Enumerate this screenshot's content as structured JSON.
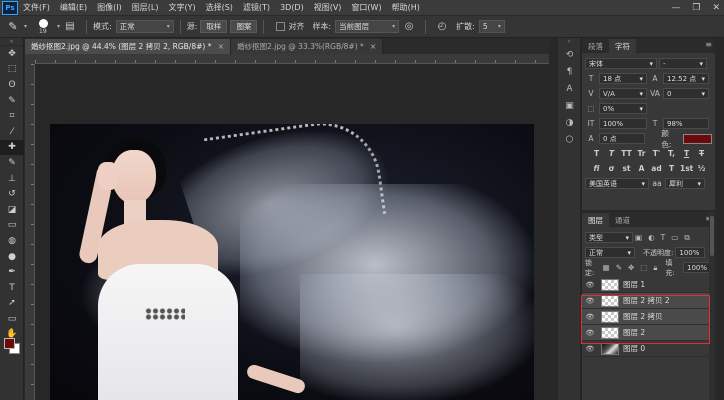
{
  "menu": {
    "logo": "Ps",
    "items": [
      "文件(F)",
      "编辑(E)",
      "图像(I)",
      "图层(L)",
      "文字(Y)",
      "选择(S)",
      "滤镜(T)",
      "3D(D)",
      "视图(V)",
      "窗口(W)",
      "帮助(H)"
    ],
    "window_controls": [
      "—",
      "❐",
      "✕"
    ]
  },
  "options": {
    "brush_size": "19",
    "mode_label": "模式:",
    "mode_value": "正常",
    "source_label": "源:",
    "sample_btn": "取样",
    "pattern_btn": "图案",
    "aligned_label": "对齐",
    "sample_label": "样本:",
    "sample_value": "当前图层",
    "diffuse_label": "扩散:",
    "diffuse_value": "5"
  },
  "tabs": [
    {
      "label": "婚纱抠图2.jpg @ 44.4% (图层 2 拷贝 2, RGB/8#) *",
      "close": "×"
    },
    {
      "label": "婚纱抠图2.jpg @ 33.3%(RGB/8#) *",
      "close": "×"
    }
  ],
  "toolbar": {
    "tools": [
      "move-icon",
      "marquee-icon",
      "lasso-icon",
      "quick-select-icon",
      "crop-icon",
      "eyedropper-icon",
      "healing-brush-icon",
      "brush-icon",
      "clone-stamp-icon",
      "history-brush-icon",
      "eraser-icon",
      "gradient-icon",
      "blur-icon",
      "dodge-icon",
      "pen-icon",
      "type-icon",
      "path-select-icon",
      "shape-icon",
      "hand-icon",
      "zoom-icon"
    ],
    "glyphs": [
      "✥",
      "⬚",
      "ʘ",
      "✎",
      "⌗",
      "⁄",
      "✚",
      "✎",
      "⊥",
      "↺",
      "◪",
      "▭",
      "◍",
      "●",
      "✒",
      "T",
      "➚",
      "▭",
      "✋",
      "⌕"
    ],
    "active_index": 6,
    "foreground_color": "#6b0b0b",
    "background_color": "#ffffff"
  },
  "character_panel": {
    "tabs": [
      "段落",
      "字符"
    ],
    "active_tab": 1,
    "font_family": "宋体",
    "font_style": "-",
    "font_size": "18 点",
    "leading": "12.52 点",
    "kerning": "V/A",
    "tracking": "0",
    "vertical_scale_field": "0%",
    "horizontal_scale": "100%",
    "vertical_scale": "98%",
    "baseline_shift": "0 点",
    "color_label": "颜色:",
    "color": "#6b0b0b",
    "type_styles": [
      "T",
      "T",
      "TT",
      "Tr",
      "T'",
      "T,",
      "T",
      "T"
    ],
    "opentype": [
      "fi",
      "σ",
      "st",
      "A",
      "ad",
      "T",
      "1st",
      "½"
    ],
    "language": "美国英语",
    "aa_label": "aa",
    "aa_value": "犀利"
  },
  "layers_panel": {
    "tabs": [
      "图层",
      "通道"
    ],
    "active_tab": 0,
    "filter_label": "类型",
    "blend_mode": "正常",
    "opacity_label": "不透明度:",
    "opacity": "100%",
    "lock_label": "锁定:",
    "fill_label": "填充:",
    "fill": "100%",
    "layers": [
      {
        "name": "图层 1",
        "visible": true,
        "selected": false,
        "thumb": "transparent"
      },
      {
        "name": "图层 2 拷贝 2",
        "visible": true,
        "selected": true,
        "thumb": "transparent"
      },
      {
        "name": "图层 2 拷贝",
        "visible": true,
        "selected": true,
        "thumb": "transparent"
      },
      {
        "name": "图层 2",
        "visible": true,
        "selected": true,
        "thumb": "transparent"
      },
      {
        "name": "图层 0",
        "visible": true,
        "selected": false,
        "thumb": "photo"
      }
    ],
    "highlight_color": "#e23030"
  }
}
